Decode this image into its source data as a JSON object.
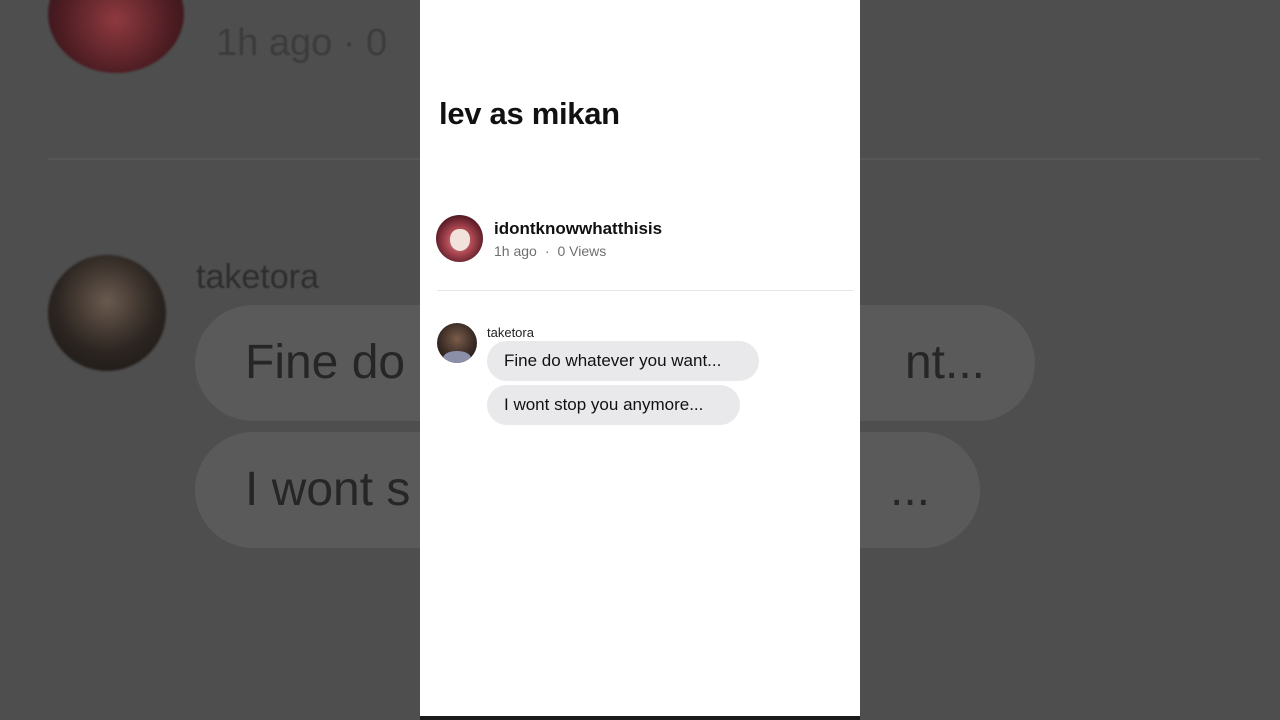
{
  "background": {
    "meta_partial": "1h ago  ·  0",
    "sender_name": "taketora",
    "bubble1_left": "Fine do",
    "bubble1_right": "nt...",
    "bubble2_left": "I wont s",
    "bubble2_right": "..."
  },
  "post": {
    "title": "lev as mikan",
    "author": {
      "username": "idontknowwhatthisis",
      "time": "1h ago",
      "separator": "·",
      "views": "0 Views"
    }
  },
  "messages": {
    "sender": "taketora",
    "bubbles": [
      "Fine do whatever you want...",
      "I wont stop you anymore..."
    ]
  },
  "icons": {
    "author_avatar": "avatar-icon",
    "sender_avatar": "avatar-icon"
  },
  "colors": {
    "panel_bg": "#ffffff",
    "outer_bg": "#4d4d4d",
    "bubble_bg": "#e9e9eb",
    "meta_text": "#6f6f6f"
  }
}
